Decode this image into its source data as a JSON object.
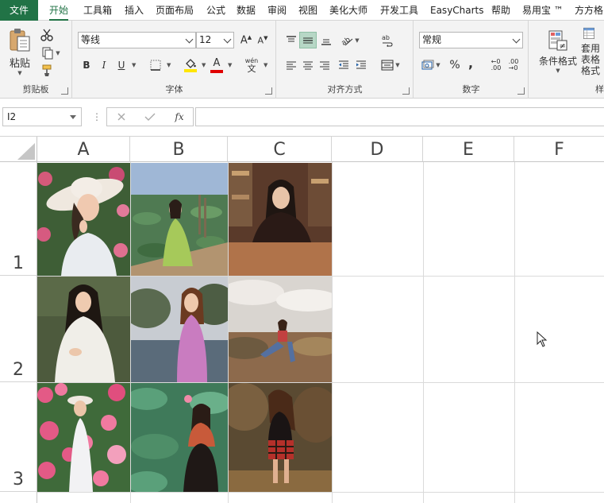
{
  "menu": {
    "items": [
      "文件",
      "开始",
      "工具箱",
      "插入",
      "页面布局",
      "公式",
      "数据",
      "审阅",
      "视图",
      "美化大师",
      "开发工具",
      "EasyCharts",
      "帮助",
      "易用宝 ™",
      "方方格"
    ],
    "active": "开始"
  },
  "ribbon": {
    "clipboard": {
      "label": "剪贴板",
      "paste": "粘贴"
    },
    "font": {
      "label": "字体",
      "font_name": "等线",
      "font_size": "12",
      "bold": "B",
      "italic": "I",
      "underline": "U",
      "phonetic": "wén"
    },
    "alignment": {
      "label": "对齐方式"
    },
    "number": {
      "label": "数字",
      "format": "常规",
      "percent": "%",
      "comma": ","
    },
    "styles": {
      "cond_format": "条件格式",
      "table_format": "套用表格格式",
      "cut_label": "样"
    }
  },
  "formula_bar": {
    "cell_ref": "I2",
    "fx": "fx",
    "content": ""
  },
  "grid": {
    "columns": [
      "A",
      "B",
      "C",
      "D",
      "E",
      "F"
    ],
    "rows": [
      "1",
      "2",
      "3"
    ]
  },
  "colors": {
    "accent": "#217346",
    "highlight_yellow": "#ffe600",
    "font_red": "#e00000"
  }
}
